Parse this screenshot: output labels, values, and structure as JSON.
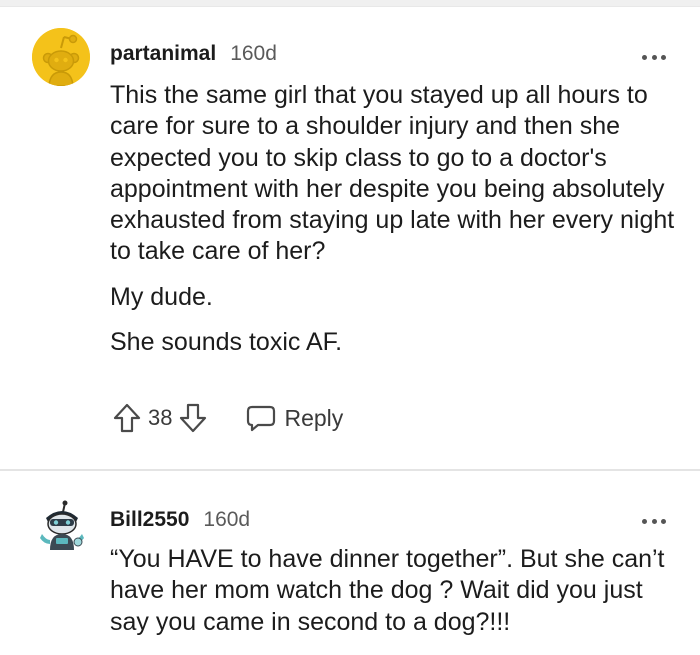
{
  "comments": [
    {
      "username": "partanimal",
      "age": "160d",
      "avatar_icon": "reddit-snoo-avatar-yellow",
      "paragraphs": [
        "This the same girl that you stayed up all hours to care for sure to a shoulder injury and then she expected you to skip class to go to a doctor's appointment with her despite you being absolutely exhausted from staying up late with her every night to take care of her?",
        "My dude.",
        "She sounds toxic AF."
      ],
      "score": "38",
      "reply_label": "Reply"
    },
    {
      "username": "Bill2550",
      "age": "160d",
      "avatar_icon": "snoo-character-avatar",
      "paragraphs": [
        "“You HAVE to have dinner together”. But she can’t have her mom watch the dog ? Wait did you just say you came in second to a dog?!!!"
      ]
    }
  ],
  "colors": {
    "avatar_yellow": "#f4c21a",
    "text": "#1c1c1c",
    "muted": "#5a5a5a"
  }
}
